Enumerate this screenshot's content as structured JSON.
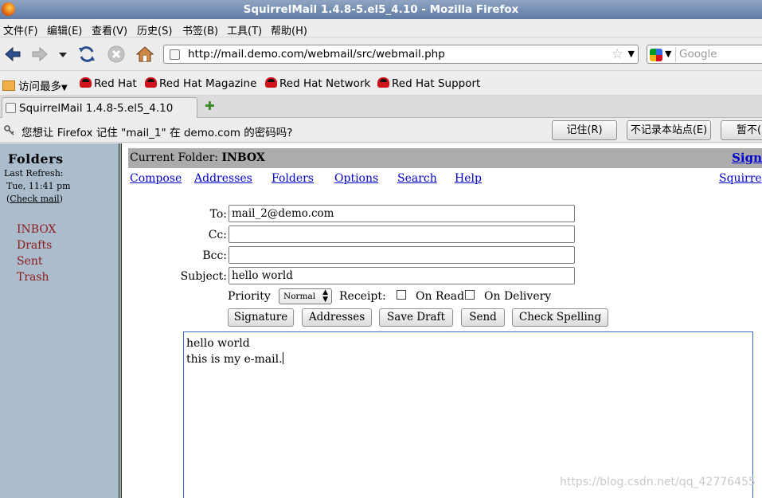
{
  "window": {
    "title": "SquirrelMail 1.4.8-5.el5_4.10 - Mozilla Firefox"
  },
  "menu": [
    {
      "label": "文件(F)"
    },
    {
      "label": "编辑(E)"
    },
    {
      "label": "查看(V)"
    },
    {
      "label": "历史(S)"
    },
    {
      "label": "书签(B)"
    },
    {
      "label": "工具(T)"
    },
    {
      "label": "帮助(H)"
    }
  ],
  "navbar": {
    "url": "http://mail.demo.com/webmail/src/webmail.php",
    "search_placeholder": "Google"
  },
  "bookmarks": {
    "most_visited": "访问最多",
    "items": [
      {
        "label": "Red Hat"
      },
      {
        "label": "Red Hat Magazine"
      },
      {
        "label": "Red Hat Network"
      },
      {
        "label": "Red Hat Support"
      }
    ]
  },
  "tab": {
    "label": "SquirrelMail  1.4.8-5.el5_4.10"
  },
  "password_bar": {
    "message": "您想让 Firefox 记住 \"mail_1\" 在 demo.com 的密码吗?",
    "remember": "记住(R)",
    "never": "不记录本站点(E)",
    "not_now": "暂不("
  },
  "sidebar": {
    "title": "Folders",
    "last_refresh": "Last Refresh:",
    "refresh_time": "Tue, 11:41 pm",
    "check_mail_open": "(",
    "check_mail": "Check mail",
    "check_mail_close": ")",
    "folders": [
      {
        "label": "INBOX"
      },
      {
        "label": "Drafts"
      },
      {
        "label": "Sent"
      },
      {
        "label": "Trash"
      }
    ]
  },
  "main": {
    "current_folder_label": "Current Folder:",
    "current_folder": "INBOX",
    "sign_out": "Sign",
    "links": [
      {
        "label": "Compose"
      },
      {
        "label": "Addresses"
      },
      {
        "label": "Folders"
      },
      {
        "label": "Options"
      },
      {
        "label": "Search"
      },
      {
        "label": "Help"
      }
    ],
    "right_link": "Squirre"
  },
  "compose": {
    "to_label": "To:",
    "to": "mail_2@demo.com",
    "cc_label": "Cc:",
    "cc": "",
    "bcc_label": "Bcc:",
    "bcc": "",
    "subject_label": "Subject:",
    "subject": "hello  world",
    "priority_label": "Priority",
    "priority": "Normal",
    "receipt_label": "Receipt:",
    "on_read": "On Read",
    "on_delivery": "On Delivery",
    "buttons": {
      "signature": "Signature",
      "addresses": "Addresses",
      "save_draft": "Save Draft",
      "send": "Send",
      "check_spelling": "Check Spelling"
    },
    "body_lines": [
      "hello world",
      "this is my e-mail."
    ]
  },
  "watermark": "https://blog.csdn.net/qq_42776455"
}
